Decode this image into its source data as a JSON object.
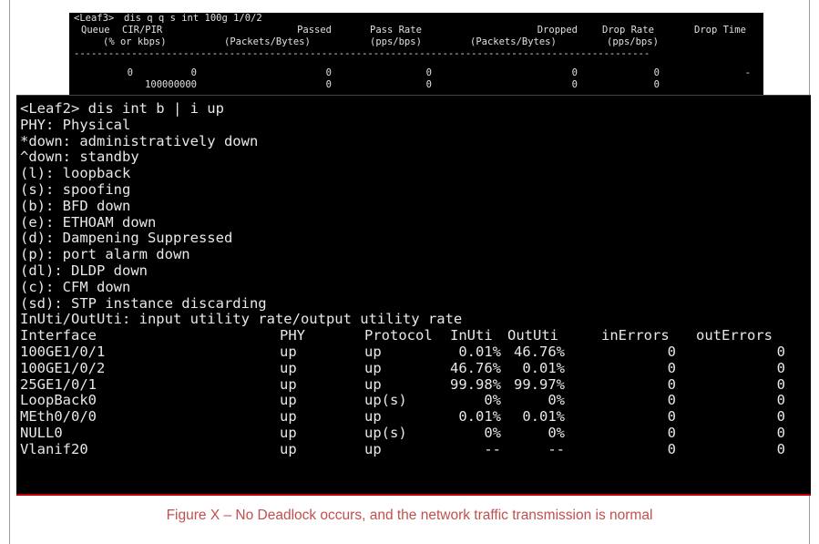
{
  "top_terminal": {
    "prompt": "<Leaf3>",
    "command": "dis q q s int 100g 1/0/2",
    "headers1": [
      "Queue",
      "CIR/PIR",
      "Passed",
      "Pass Rate",
      "Dropped",
      "Drop Rate",
      "Drop Time"
    ],
    "headers2": [
      "(% or kbps)",
      "(Packets/Bytes)",
      "(pps/bps)",
      "(Packets/Bytes)",
      "(pps/bps)"
    ],
    "divider": "----------------------------------------------------------------------------------------------------",
    "row1": [
      "0",
      "0",
      "0",
      "0",
      "0",
      "0",
      "-"
    ],
    "row2": [
      "100000000",
      "0",
      "0",
      "0",
      "0"
    ]
  },
  "main_terminal": {
    "command_line": "<Leaf2> dis int b | i up",
    "legend": [
      "PHY: Physical",
      "*down: administratively down",
      "^down: standby",
      "(l): loopback",
      "(s): spoofing",
      "(b): BFD down",
      "(e): ETHOAM down",
      "(d): Dampening Suppressed",
      "(p): port alarm down",
      "(dl): DLDP down",
      "(c): CFM down",
      "(sd): STP instance discarding",
      "InUti/OutUti: input utility rate/output utility rate"
    ],
    "columns": [
      "Interface",
      "PHY",
      "Protocol",
      "InUti",
      "OutUti",
      "inErrors",
      "outErrors"
    ],
    "rows": [
      {
        "iface": "100GE1/0/1",
        "phy": "up",
        "proto": "up",
        "inuti": "0.01%",
        "oututi": "46.76%",
        "inerr": "0",
        "outerr": "0"
      },
      {
        "iface": "100GE1/0/2",
        "phy": "up",
        "proto": "up",
        "inuti": "46.76%",
        "oututi": "0.01%",
        "inerr": "0",
        "outerr": "0"
      },
      {
        "iface": "25GE1/0/1",
        "phy": "up",
        "proto": "up",
        "inuti": "99.98%",
        "oututi": "99.97%",
        "inerr": "0",
        "outerr": "0"
      },
      {
        "iface": "LoopBack0",
        "phy": "up",
        "proto": "up(s)",
        "inuti": "0%",
        "oututi": "0%",
        "inerr": "0",
        "outerr": "0"
      },
      {
        "iface": "MEth0/0/0",
        "phy": "up",
        "proto": "up",
        "inuti": "0.01%",
        "oututi": "0.01%",
        "inerr": "0",
        "outerr": "0"
      },
      {
        "iface": "NULL0",
        "phy": "up",
        "proto": "up(s)",
        "inuti": "0%",
        "oututi": "0%",
        "inerr": "0",
        "outerr": "0"
      },
      {
        "iface": "Vlanif20",
        "phy": "up",
        "proto": "up",
        "inuti": "--",
        "oututi": "--",
        "inerr": "0",
        "outerr": "0"
      }
    ]
  },
  "caption": "Figure X – No Deadlock occurs, and the network traffic transmission is normal",
  "colors": {
    "terminal_bg": "#000000",
    "terminal_fg": "#e8e8e8",
    "caption": "#c0504d",
    "rule": "#c00000"
  }
}
